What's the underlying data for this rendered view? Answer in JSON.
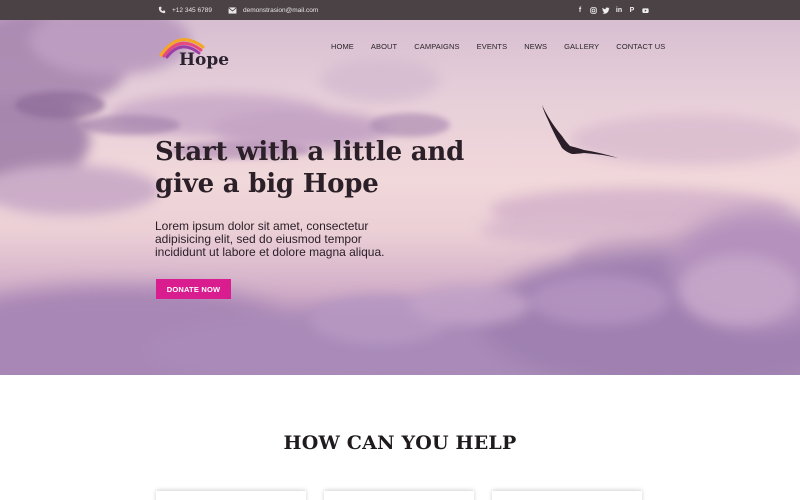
{
  "topbar": {
    "phone": "+12 345 6789",
    "email": "demonstrasion@mail.com",
    "phone_icon": "phone-icon",
    "email_icon": "envelope-icon",
    "social": [
      "facebook-icon",
      "instagram-icon",
      "twitter-icon",
      "linkedin-icon",
      "pinterest-icon",
      "youtube-icon"
    ],
    "background": "#4a4245"
  },
  "logo": {
    "text": "Hope"
  },
  "nav": {
    "items": [
      "HOME",
      "ABOUT",
      "CAMPAIGNS",
      "EVENTS",
      "NEWS",
      "GALLERY",
      "CONTACT US"
    ]
  },
  "hero": {
    "headline": "Start with a little and give a big Hope",
    "subtitle": "Lorem ipsum dolor sit amet, consectetur adipisicing elit, sed do eiusmod tempor incididunt ut labore et dolore magna aliqua.",
    "cta": "DONATE NOW",
    "cta_color": "#d91d8e"
  },
  "section": {
    "title": "HOW CAN YOU HELP"
  }
}
